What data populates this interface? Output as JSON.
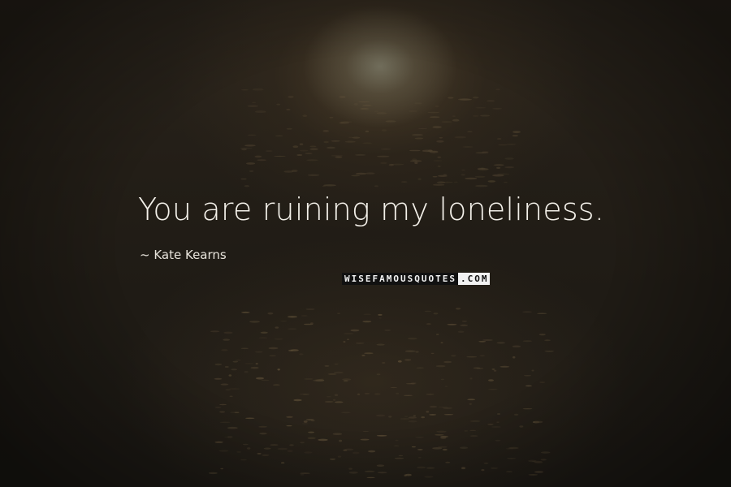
{
  "quote": {
    "text": "You are ruining my loneliness.",
    "author": "~ Kate Kearns"
  },
  "watermark": {
    "main": "WISEFAMOUSQUOTES",
    "tld": ".COM"
  },
  "colors": {
    "background": "#1f1b15",
    "text": "#f4f1ea",
    "sun_glow": "#787664"
  }
}
